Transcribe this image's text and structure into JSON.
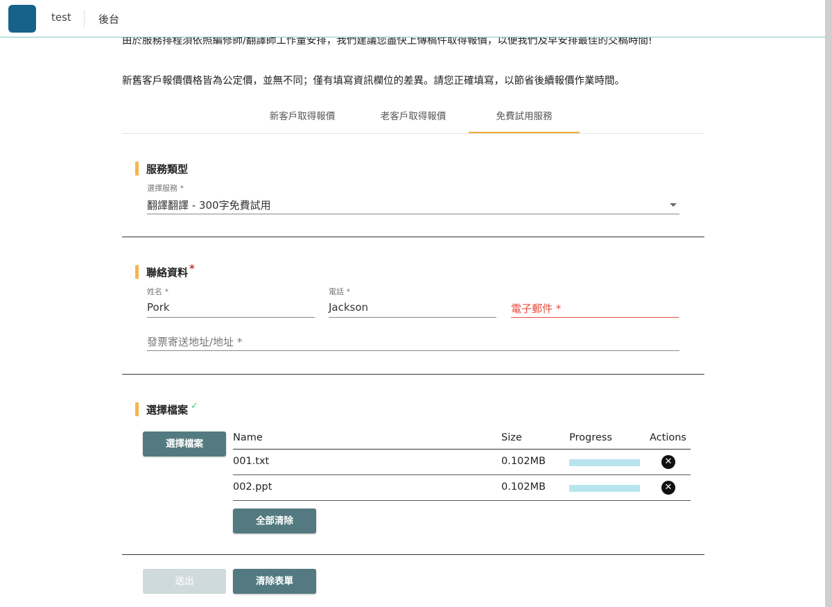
{
  "header": {
    "brand": "test",
    "nav_item": "後台"
  },
  "intro": {
    "line1": "由於服務排程須依照編修師/翻譯師工作量安排，我們建議您盡快上傳稿件取得報價，以便我們及早安排最佳的交稿時間!",
    "line2": "新舊客戶報價價格皆為公定價，並無不同；僅有填寫資訊欄位的差異。請您正確填寫，以節省後續報價作業時間。"
  },
  "tabs": [
    {
      "label": "新客戶取得報價"
    },
    {
      "label": "老客戶取得報價"
    },
    {
      "label": "免費試用服務",
      "active": true
    }
  ],
  "service": {
    "title": "服務類型",
    "select_label": "選擇服務 *",
    "select_value": "翻譯翻譯 - 300字免費試用"
  },
  "contact": {
    "title": "聯絡資料",
    "required_mark": "*",
    "name_label": "姓名 *",
    "name_value": "Pork",
    "phone_label": "電話 *",
    "phone_value": "Jackson",
    "email_placeholder": "電子郵件 *",
    "address_placeholder": "發票寄送地址/地址 *"
  },
  "files": {
    "title": "選擇檔案",
    "check_mark": "✓",
    "choose_button": "選擇檔案",
    "columns": [
      "Name",
      "Size",
      "Progress",
      "Actions"
    ],
    "rows": [
      {
        "name": "001.txt",
        "size": "0.102MB",
        "progress": 1.0
      },
      {
        "name": "002.ppt",
        "size": "0.102MB",
        "progress": 1.0
      }
    ],
    "clear_all_button": "全部清除"
  },
  "actions": {
    "submit_button": "送出",
    "reset_button": "清除表單"
  },
  "colors": {
    "accent_bar": "#f7b54a",
    "button": "#537a80",
    "error": "#e74c3c",
    "logo": "#16628a"
  },
  "icons": {
    "remove": "close-circle-icon",
    "dropdown": "chevron-down-icon"
  }
}
